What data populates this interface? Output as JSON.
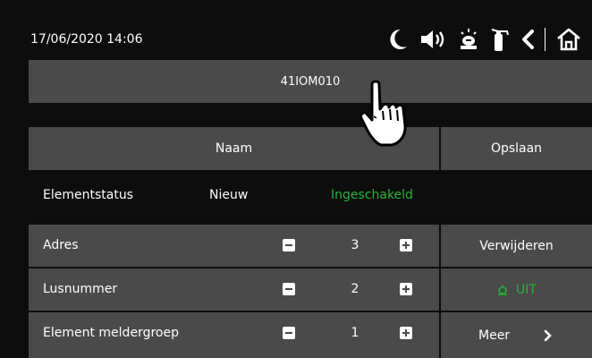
{
  "status_bar": {
    "datetime": "17/06/2020 14:06",
    "icons": [
      "moon-icon",
      "speaker-icon",
      "siren-icon",
      "fire-extinguisher-icon",
      "back-icon",
      "home-icon"
    ]
  },
  "device": {
    "id": "41IOM010"
  },
  "header": {
    "name_label": "Naam",
    "save_label": "Opslaan"
  },
  "element_status": {
    "label": "Elementstatus",
    "new": "Nieuw",
    "state": "Ingeschakeld"
  },
  "params": [
    {
      "label": "Adres",
      "value": "3"
    },
    {
      "label": "Lusnummer",
      "value": "2"
    },
    {
      "label": "Element meldergroep",
      "value": "1"
    }
  ],
  "actions": {
    "delete_label": "Verwijderen",
    "alarm_label": "UIT",
    "more_label": "Meer"
  },
  "colors": {
    "panel": "#4a4a4a",
    "background": "#0d0d0d",
    "active_green": "#27b33a"
  }
}
